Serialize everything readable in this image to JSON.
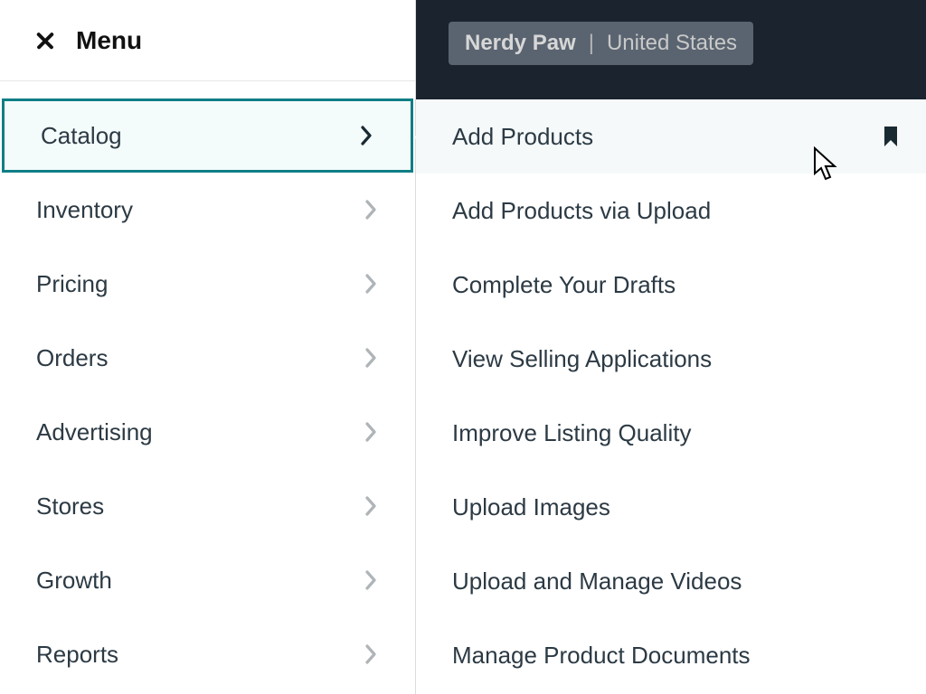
{
  "header": {
    "menu_label": "Menu",
    "store_brand": "Nerdy Paw",
    "store_region": "United States"
  },
  "sidebar": {
    "items": [
      {
        "label": "Catalog",
        "active": true
      },
      {
        "label": "Inventory",
        "active": false
      },
      {
        "label": "Pricing",
        "active": false
      },
      {
        "label": "Orders",
        "active": false
      },
      {
        "label": "Advertising",
        "active": false
      },
      {
        "label": "Stores",
        "active": false
      },
      {
        "label": "Growth",
        "active": false
      },
      {
        "label": "Reports",
        "active": false
      }
    ]
  },
  "submenu": {
    "items": [
      {
        "label": "Add Products",
        "hover": true,
        "bookmarked": true
      },
      {
        "label": "Add Products via Upload"
      },
      {
        "label": "Complete Your Drafts"
      },
      {
        "label": "View Selling Applications"
      },
      {
        "label": "Improve Listing Quality"
      },
      {
        "label": "Upload Images"
      },
      {
        "label": "Upload and Manage Videos"
      },
      {
        "label": "Manage Product Documents"
      }
    ]
  }
}
